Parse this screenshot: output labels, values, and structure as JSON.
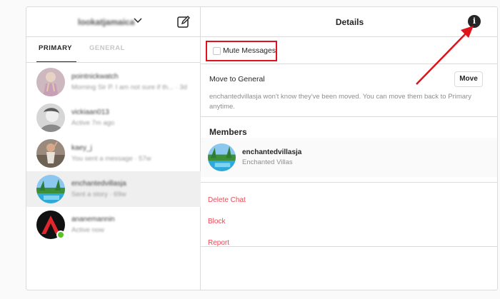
{
  "left_panel": {
    "account_name": "lookatjamaica",
    "tabs": [
      {
        "label": "PRIMARY",
        "active": true
      },
      {
        "label": "GENERAL",
        "active": false
      }
    ],
    "conversations": [
      {
        "name": "pointnickwatch",
        "preview": "Morning Sir P. I am not sure if th... · 3d",
        "selected": false,
        "online": false
      },
      {
        "name": "vickiaan013",
        "preview": "Active 7m ago",
        "selected": false,
        "online": false
      },
      {
        "name": "kaey_j",
        "preview": "You sent a message · 57w",
        "selected": false,
        "online": false
      },
      {
        "name": "enchantedvillasja",
        "preview": "Sent a story · 69w",
        "selected": true,
        "online": false
      },
      {
        "name": "ananemannin",
        "preview": "Active now",
        "selected": false,
        "online": true
      }
    ]
  },
  "details": {
    "title": "Details",
    "mute_label": "Mute Messages",
    "move_label": "Move to General",
    "move_button": "Move",
    "move_description": "enchantedvillasja won't know they've been moved. You can move them back to Primary anytime.",
    "members_title": "Members",
    "member": {
      "username": "enchantedvillasja",
      "full_name": "Enchanted Villas"
    },
    "actions": [
      "Delete Chat",
      "Block",
      "Report"
    ]
  },
  "colors": {
    "annotation_red": "#e0121b",
    "danger_text": "#ed4956",
    "online_green": "#58c322"
  },
  "icons": {
    "compose": "compose-icon",
    "info": "info-icon",
    "chevron": "chevron-down-icon"
  }
}
